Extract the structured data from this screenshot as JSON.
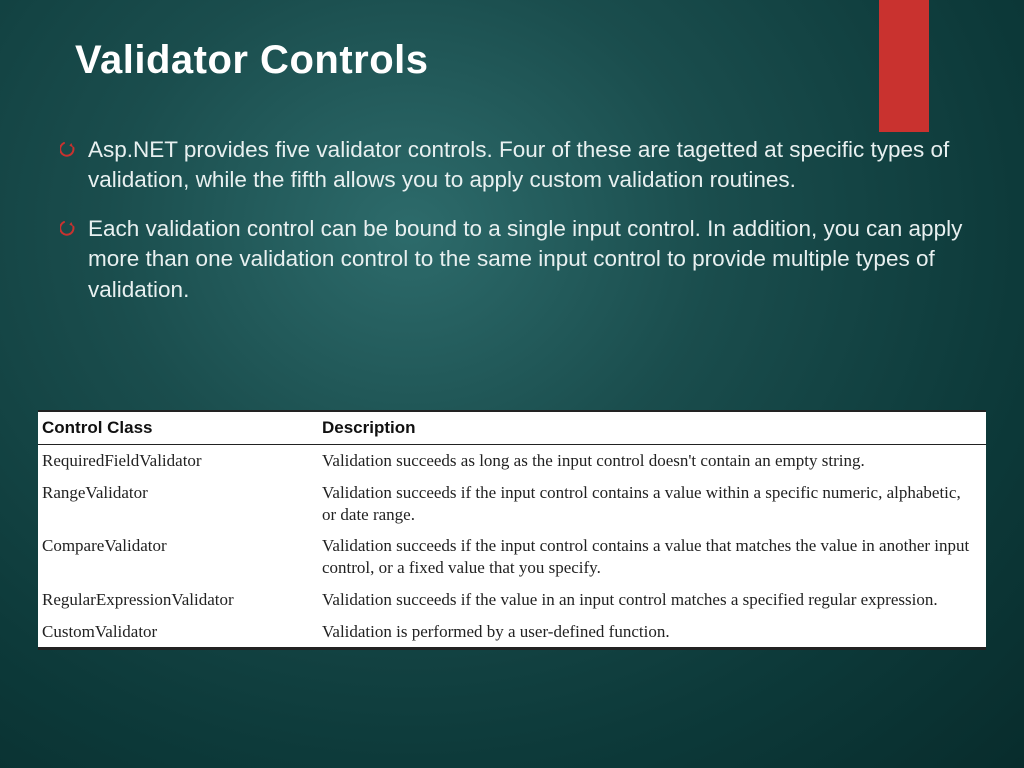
{
  "accent_color": "#c9322f",
  "title": "Validator Controls",
  "bullets": [
    "Asp.NET provides five validator controls. Four of these are tagetted at specific types of validation, while the fifth allows you to apply custom validation routines.",
    "Each validation control can be bound to a single input control. In addition, you can apply more than one validation control to the same input control to provide multiple types of validation."
  ],
  "table": {
    "headers": [
      "Control Class",
      "Description"
    ],
    "rows": [
      [
        "RequiredFieldValidator",
        "Validation succeeds as long as the input control doesn't contain an empty string."
      ],
      [
        "RangeValidator",
        "Validation succeeds if the input control contains a value within a specific numeric, alphabetic, or date range."
      ],
      [
        "CompareValidator",
        "Validation succeeds if the input control contains a value that matches the value in another input control, or a fixed value that you specify."
      ],
      [
        "RegularExpressionValidator",
        "Validation succeeds if the value in an input control matches a specified regular expression."
      ],
      [
        "CustomValidator",
        "Validation is performed by a user-defined function."
      ]
    ]
  }
}
